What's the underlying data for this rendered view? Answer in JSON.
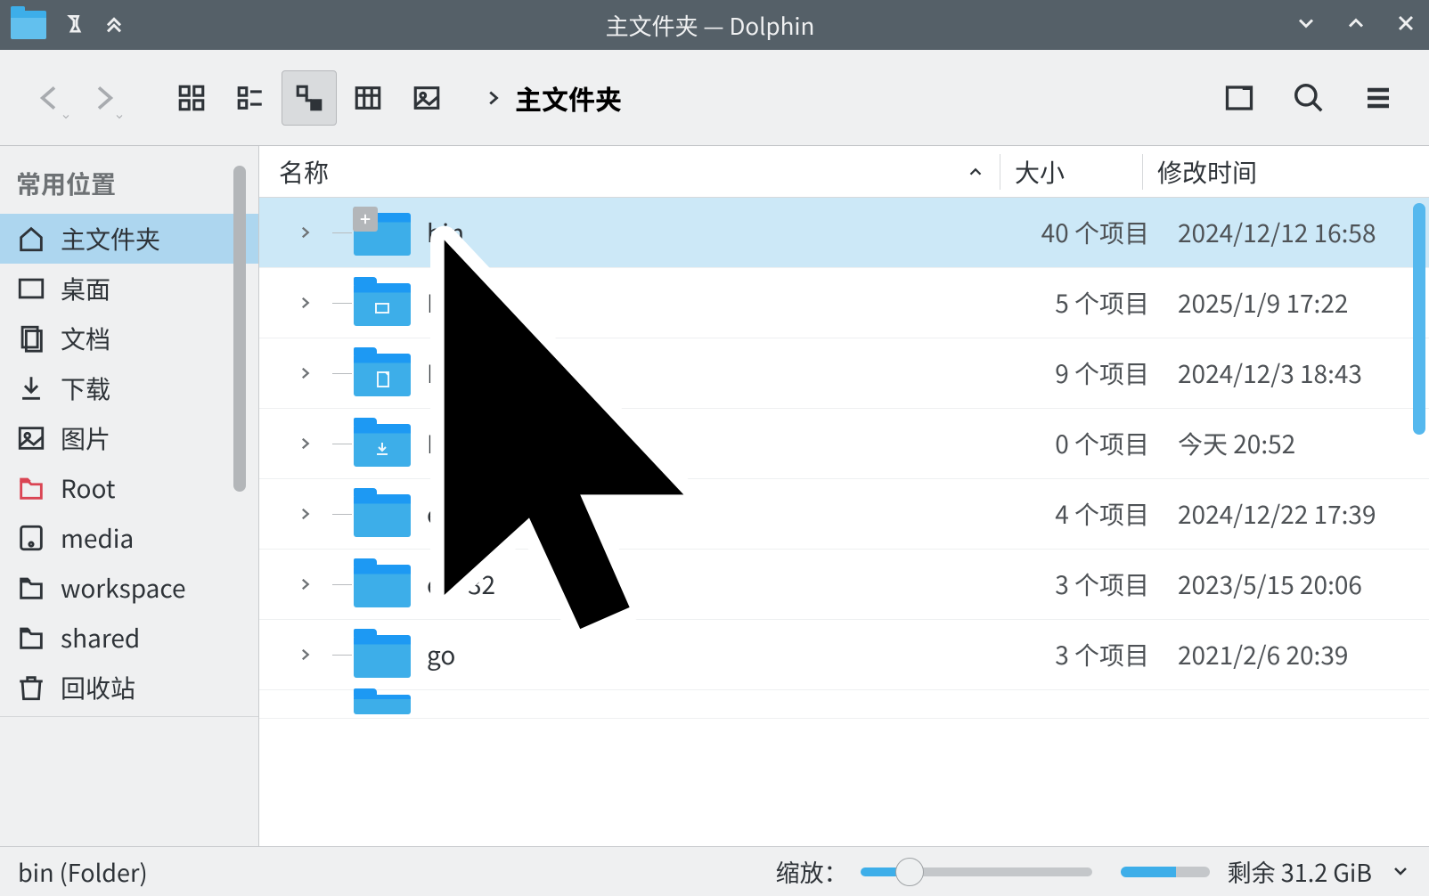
{
  "window": {
    "title": "主文件夹 — Dolphin"
  },
  "toolbar": {
    "breadcrumb": "主文件夹"
  },
  "sidebar": {
    "heading": "常用位置",
    "items": [
      {
        "label": "主文件夹",
        "icon": "home",
        "selected": true
      },
      {
        "label": "桌面",
        "icon": "desktop"
      },
      {
        "label": "文档",
        "icon": "documents"
      },
      {
        "label": "下载",
        "icon": "downloads"
      },
      {
        "label": "图片",
        "icon": "pictures"
      },
      {
        "label": "Root",
        "icon": "root"
      },
      {
        "label": "media",
        "icon": "drive"
      },
      {
        "label": "workspace",
        "icon": "folder"
      },
      {
        "label": "shared",
        "icon": "folder"
      },
      {
        "label": "回收站",
        "icon": "trash"
      }
    ]
  },
  "columns": {
    "name": "名称",
    "size": "大小",
    "date": "修改时间"
  },
  "files": [
    {
      "name": "bin",
      "size": "40 个项目",
      "date": "2024/12/12 16:58",
      "selected": true,
      "badge": true
    },
    {
      "name": "Desktop",
      "size": "5 个项目",
      "date": "2025/1/9 17:22",
      "overlay": "desktop"
    },
    {
      "name": "Documents",
      "size": "9 个项目",
      "date": "2024/12/3 18:43",
      "overlay": "doc"
    },
    {
      "name": "Downloads",
      "size": "0 个项目",
      "date": "今天 20:52",
      "overlay": "download"
    },
    {
      "name": "env",
      "size": "4 个项目",
      "date": "2024/12/22 17:39"
    },
    {
      "name": "esp32",
      "size": "3 个项目",
      "date": "2023/5/15 20:06"
    },
    {
      "name": "go",
      "size": "3 个项目",
      "date": "2021/2/6 20:39"
    }
  ],
  "statusbar": {
    "selection": "bin (Folder)",
    "zoom_label": "缩放：",
    "free_space": "剩余 31.2 GiB"
  }
}
